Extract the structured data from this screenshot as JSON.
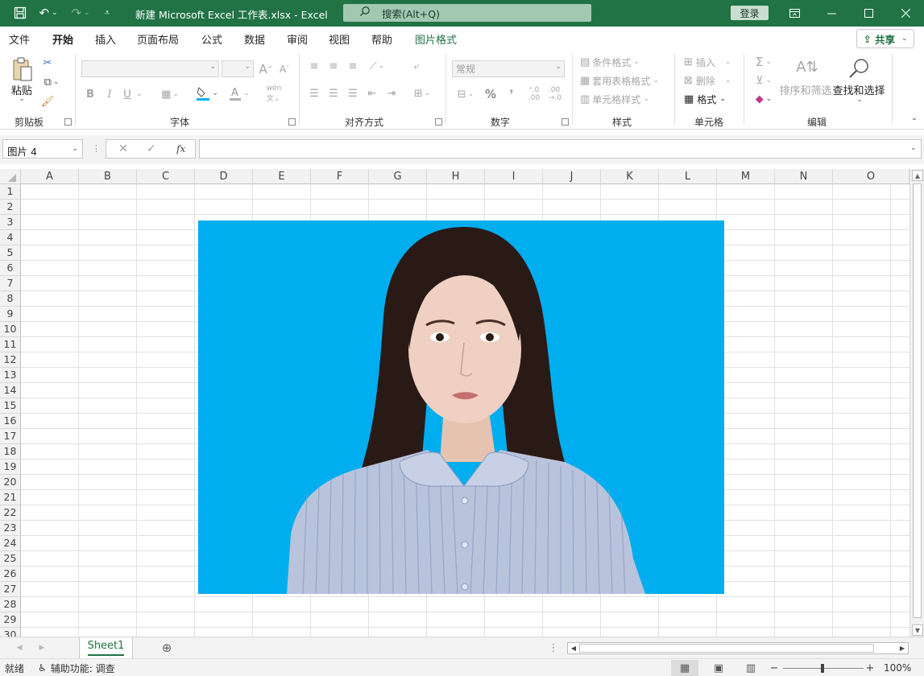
{
  "titlebar": {
    "document_title": "新建 Microsoft Excel 工作表.xlsx  -  Excel",
    "search_placeholder": "搜索(Alt+Q)",
    "login_label": "登录"
  },
  "menu_tabs": [
    {
      "label": "文件"
    },
    {
      "label": "开始",
      "active": true
    },
    {
      "label": "插入"
    },
    {
      "label": "页面布局"
    },
    {
      "label": "公式"
    },
    {
      "label": "数据"
    },
    {
      "label": "审阅"
    },
    {
      "label": "视图"
    },
    {
      "label": "帮助"
    },
    {
      "label": "图片格式",
      "contextual": true
    }
  ],
  "share_label": "共享",
  "ribbon": {
    "clipboard": {
      "paste_label": "粘贴",
      "group_label": "剪贴板"
    },
    "font": {
      "group_label": "字体",
      "bold": "B",
      "italic": "I",
      "underline": "U",
      "grow": "A",
      "shrink": "A"
    },
    "alignment": {
      "group_label": "对齐方式"
    },
    "number": {
      "format_value": "常规",
      "group_label": "数字",
      "percent": "%"
    },
    "styles": {
      "conditional_format": "条件格式",
      "format_as_table": "套用表格格式",
      "cell_styles": "单元格样式",
      "group_label": "样式"
    },
    "cells": {
      "insert": "插入",
      "delete": "删除",
      "format": "格式",
      "group_label": "单元格"
    },
    "editing": {
      "sum": "Σ",
      "sort_filter": "排序和筛选",
      "find_select": "查找和选择",
      "group_label": "编辑"
    }
  },
  "formula_bar": {
    "name_box": "图片 4",
    "fx": "fx",
    "formula_value": ""
  },
  "sheet": {
    "columns": [
      "A",
      "B",
      "C",
      "D",
      "E",
      "F",
      "G",
      "H",
      "I",
      "J",
      "K",
      "L",
      "M",
      "N",
      "O"
    ],
    "rows": [
      "1",
      "2",
      "3",
      "4",
      "5",
      "6",
      "7",
      "8",
      "9",
      "10",
      "11",
      "12",
      "13",
      "14",
      "15",
      "16",
      "17",
      "18",
      "19",
      "20",
      "21",
      "22",
      "23",
      "24",
      "25",
      "26",
      "27",
      "28",
      "29",
      "30"
    ],
    "picture": {
      "name": "图片 4",
      "background_color": "#00adef"
    }
  },
  "sheet_tabs": [
    {
      "label": "Sheet1",
      "active": true
    }
  ],
  "statusbar": {
    "ready": "就绪",
    "accessibility": "辅助功能: 调查",
    "zoom": "100%"
  },
  "colors": {
    "accent": "#217346",
    "photo_bg": "#00adef"
  }
}
